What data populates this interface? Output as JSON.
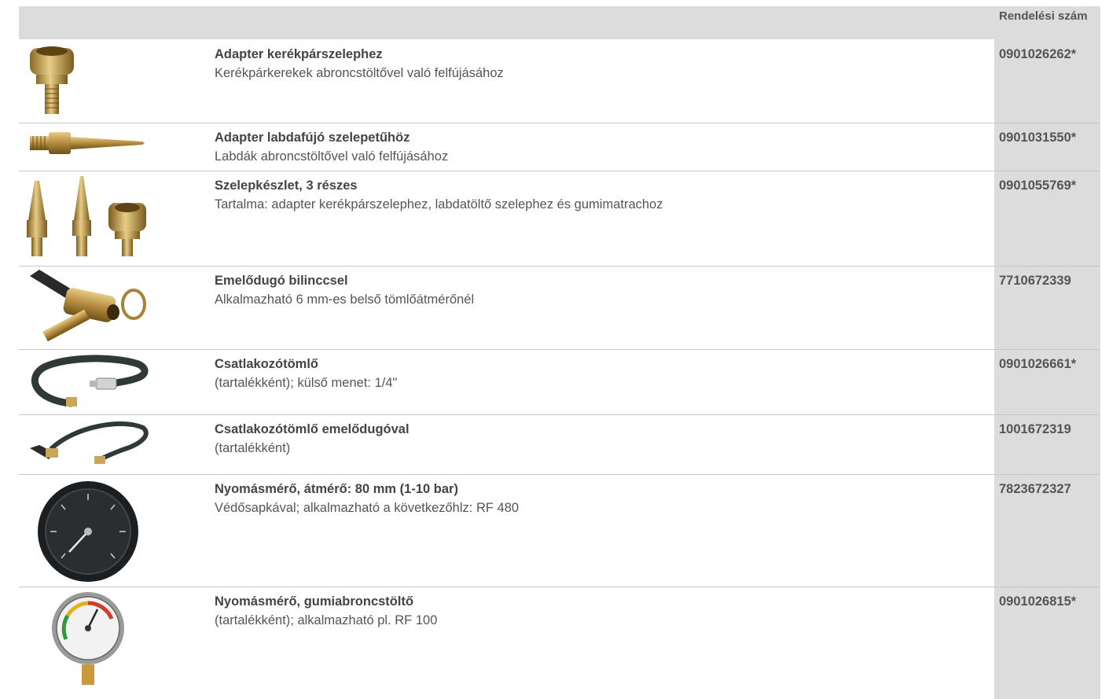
{
  "header": {
    "order_label": "Rendelési szám"
  },
  "rows": [
    {
      "title": "Adapter kerékpárszelephez",
      "desc": "Kerékpárkerekek abroncstöltővel való felfújásához",
      "code": "0901026262*",
      "icon": "bicycle-valve-adapter-icon"
    },
    {
      "title": "Adapter labdafújó szelepetűhöz",
      "desc": "Labdák abroncstöltővel való felfújásához",
      "code": "0901031550*",
      "icon": "ball-needle-adapter-icon"
    },
    {
      "title": "Szelepkészlet, 3 részes",
      "desc": "Tartalma: adapter kerékpárszelephez, labdatöltő szelephez és gumimatrachoz",
      "code": "0901055769*",
      "icon": "valve-set-icon"
    },
    {
      "title": "Emelődugó bilinccsel",
      "desc": "Alkalmazható 6 mm-es belső tömlőátmérőnél",
      "code": "7710672339",
      "icon": "lever-chuck-clamp-icon"
    },
    {
      "title": "Csatlakozótömlő",
      "desc": "(tartalékként); külső menet: 1/4\"",
      "code": "0901026661*",
      "icon": "connection-hose-icon"
    },
    {
      "title": "Csatlakozótömlő emelődugóval",
      "desc": "(tartalékként)",
      "code": "1001672319",
      "icon": "hose-with-lever-chuck-icon"
    },
    {
      "title": "Nyomásmérő, átmérő: 80 mm (1-10 bar)",
      "desc": "Védősapkával; alkalmazható a következőhlz: RF 480",
      "code": "7823672327",
      "icon": "black-pressure-gauge-icon"
    },
    {
      "title": "Nyomásmérő, gumiabroncstöltő",
      "desc": "(tartalékként); alkalmazható pl. RF 100",
      "code": "0901026815*",
      "icon": "tire-pressure-gauge-icon"
    }
  ]
}
